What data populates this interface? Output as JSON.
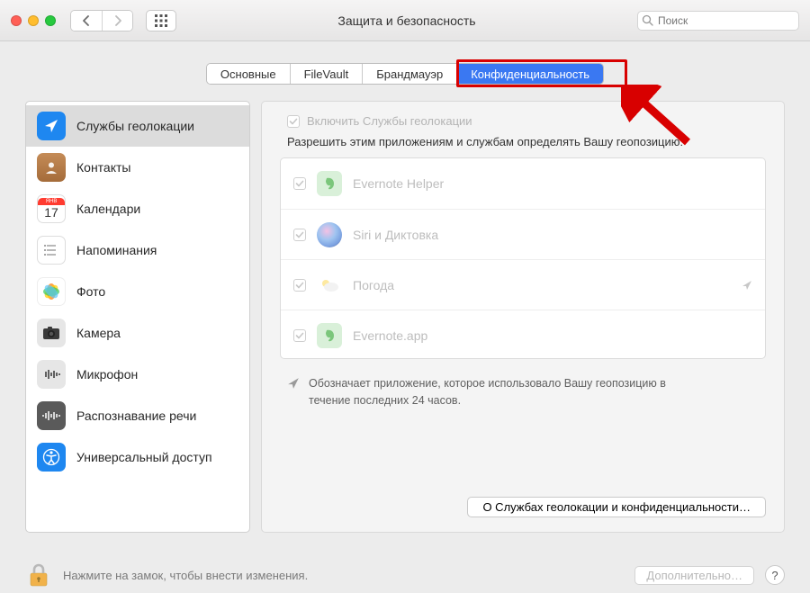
{
  "window": {
    "title": "Защита и безопасность"
  },
  "search": {
    "placeholder": "Поиск"
  },
  "tabs": [
    {
      "label": "Основные"
    },
    {
      "label": "FileVault"
    },
    {
      "label": "Брандмауэр"
    },
    {
      "label": "Конфиденциальность",
      "active": true
    }
  ],
  "sidebar": {
    "items": [
      {
        "label": "Службы геолокации",
        "icon": "location",
        "selected": true
      },
      {
        "label": "Контакты",
        "icon": "contacts"
      },
      {
        "label": "Календари",
        "icon": "calendar"
      },
      {
        "label": "Напоминания",
        "icon": "reminders"
      },
      {
        "label": "Фото",
        "icon": "photos"
      },
      {
        "label": "Камера",
        "icon": "camera"
      },
      {
        "label": "Микрофон",
        "icon": "microphone"
      },
      {
        "label": "Распознавание речи",
        "icon": "speech"
      },
      {
        "label": "Универсальный доступ",
        "icon": "accessibility"
      }
    ]
  },
  "main": {
    "enable_label": "Включить Службы геолокации",
    "description": "Разрешить этим приложениям и службам определять Вашу геопозицию:",
    "apps": [
      {
        "name": "Evernote Helper",
        "checked": true,
        "icon": "evernote"
      },
      {
        "name": "Siri и Диктовка",
        "checked": true,
        "icon": "siri"
      },
      {
        "name": "Погода",
        "checked": true,
        "icon": "weather",
        "indicator": true
      },
      {
        "name": "Evernote.app",
        "checked": true,
        "icon": "evernote"
      }
    ],
    "note": "Обозначает приложение, которое использовало Вашу геопозицию в течение последних 24 часов.",
    "about_button": "О Службах геолокации и конфиденциальности…"
  },
  "footer": {
    "lock_label": "Нажмите на замок, чтобы внести изменения.",
    "advanced": "Дополнительно…"
  }
}
